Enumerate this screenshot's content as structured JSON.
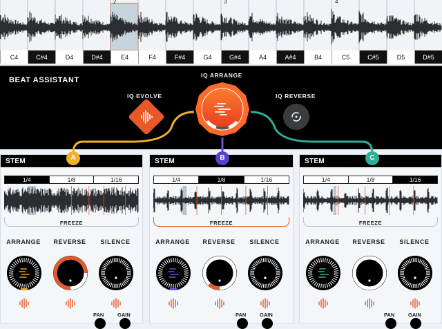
{
  "waveform_strip": {
    "bar_numbers": [
      "2",
      "3",
      "4"
    ],
    "keys": [
      {
        "note": "C4",
        "black": false
      },
      {
        "note": "C#4",
        "black": true
      },
      {
        "note": "D4",
        "black": false
      },
      {
        "note": "D#4",
        "black": true
      },
      {
        "note": "E4",
        "black": false,
        "selected": true
      },
      {
        "note": "F4",
        "black": false
      },
      {
        "note": "F#4",
        "black": true
      },
      {
        "note": "G4",
        "black": false
      },
      {
        "note": "G#4",
        "black": true
      },
      {
        "note": "A4",
        "black": false
      },
      {
        "note": "A#4",
        "black": true
      },
      {
        "note": "B4",
        "black": false
      },
      {
        "note": "C5",
        "black": false
      },
      {
        "note": "C#5",
        "black": true
      },
      {
        "note": "D5",
        "black": false
      },
      {
        "note": "D#5",
        "black": true
      }
    ]
  },
  "beat_assistant": {
    "title": "BEAT ASSISTANT",
    "iq_arrange": "IQ ARRANGE",
    "iq_evolve": "IQ EVOLVE",
    "iq_reverse": "IQ REVERSE"
  },
  "stems": [
    {
      "id": "A",
      "title": "STEM",
      "grid": [
        "1/4",
        "1/8",
        "1/16"
      ],
      "grid_selected": "1/4",
      "freeze": "FREEZE",
      "arrange": "ARRANGE",
      "reverse": "REVERSE",
      "silence": "SILENCE",
      "arrange_color": "#e0a412",
      "reverse_level": 0.75,
      "badge_color": "#f0b12a"
    },
    {
      "id": "B",
      "title": "STEM",
      "grid": [
        "1/4",
        "1/8",
        "1/16"
      ],
      "grid_selected": "1/8",
      "freeze": "FREEZE",
      "arrange": "ARRANGE",
      "reverse": "REVERSE",
      "silence": "SILENCE",
      "arrange_color": "#6b4fd6",
      "reverse_level": 0.12,
      "badge_color": "#5a3fc8",
      "pan": "PAN",
      "gain": "GAIN"
    },
    {
      "id": "C",
      "title": "STEM",
      "grid": [
        "1/4",
        "1/8",
        "1/16"
      ],
      "grid_selected": "1/16",
      "freeze": "FREEZE",
      "arrange": "ARRANGE",
      "reverse": "REVERSE",
      "silence": "SILENCE",
      "arrange_color": "#2fae9a",
      "reverse_level": 0,
      "badge_color": "#2fae9a",
      "pan": "PAN",
      "gain": "GAIN"
    }
  ],
  "stem_a_pan": "PAN",
  "stem_a_gain": "GAIN",
  "colors": {
    "accent": "#e8592a",
    "panel": "#000000",
    "stem_bg": "#f4f7fa"
  }
}
